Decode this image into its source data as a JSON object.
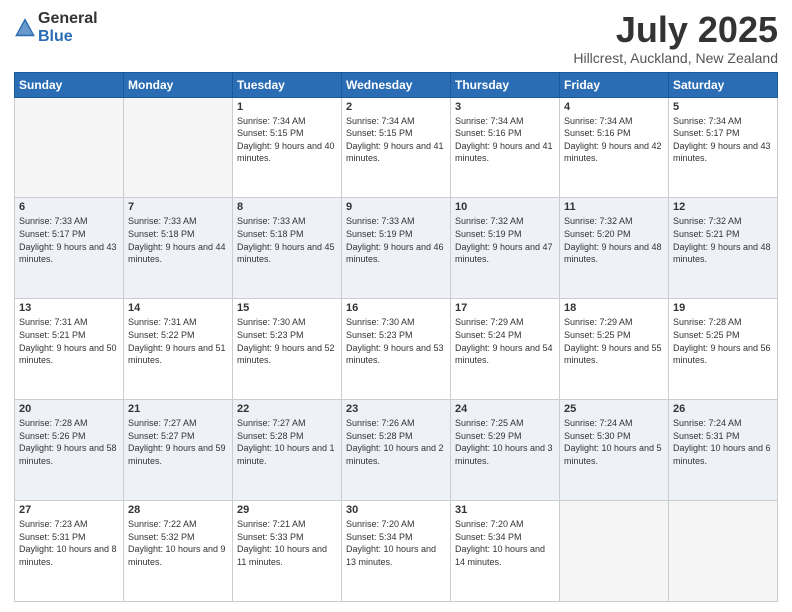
{
  "logo": {
    "general": "General",
    "blue": "Blue"
  },
  "title": "July 2025",
  "location": "Hillcrest, Auckland, New Zealand",
  "headers": [
    "Sunday",
    "Monday",
    "Tuesday",
    "Wednesday",
    "Thursday",
    "Friday",
    "Saturday"
  ],
  "weeks": [
    [
      {
        "day": "",
        "info": ""
      },
      {
        "day": "",
        "info": ""
      },
      {
        "day": "1",
        "info": "Sunrise: 7:34 AM\nSunset: 5:15 PM\nDaylight: 9 hours and 40 minutes."
      },
      {
        "day": "2",
        "info": "Sunrise: 7:34 AM\nSunset: 5:15 PM\nDaylight: 9 hours and 41 minutes."
      },
      {
        "day": "3",
        "info": "Sunrise: 7:34 AM\nSunset: 5:16 PM\nDaylight: 9 hours and 41 minutes."
      },
      {
        "day": "4",
        "info": "Sunrise: 7:34 AM\nSunset: 5:16 PM\nDaylight: 9 hours and 42 minutes."
      },
      {
        "day": "5",
        "info": "Sunrise: 7:34 AM\nSunset: 5:17 PM\nDaylight: 9 hours and 43 minutes."
      }
    ],
    [
      {
        "day": "6",
        "info": "Sunrise: 7:33 AM\nSunset: 5:17 PM\nDaylight: 9 hours and 43 minutes."
      },
      {
        "day": "7",
        "info": "Sunrise: 7:33 AM\nSunset: 5:18 PM\nDaylight: 9 hours and 44 minutes."
      },
      {
        "day": "8",
        "info": "Sunrise: 7:33 AM\nSunset: 5:18 PM\nDaylight: 9 hours and 45 minutes."
      },
      {
        "day": "9",
        "info": "Sunrise: 7:33 AM\nSunset: 5:19 PM\nDaylight: 9 hours and 46 minutes."
      },
      {
        "day": "10",
        "info": "Sunrise: 7:32 AM\nSunset: 5:19 PM\nDaylight: 9 hours and 47 minutes."
      },
      {
        "day": "11",
        "info": "Sunrise: 7:32 AM\nSunset: 5:20 PM\nDaylight: 9 hours and 48 minutes."
      },
      {
        "day": "12",
        "info": "Sunrise: 7:32 AM\nSunset: 5:21 PM\nDaylight: 9 hours and 48 minutes."
      }
    ],
    [
      {
        "day": "13",
        "info": "Sunrise: 7:31 AM\nSunset: 5:21 PM\nDaylight: 9 hours and 50 minutes."
      },
      {
        "day": "14",
        "info": "Sunrise: 7:31 AM\nSunset: 5:22 PM\nDaylight: 9 hours and 51 minutes."
      },
      {
        "day": "15",
        "info": "Sunrise: 7:30 AM\nSunset: 5:23 PM\nDaylight: 9 hours and 52 minutes."
      },
      {
        "day": "16",
        "info": "Sunrise: 7:30 AM\nSunset: 5:23 PM\nDaylight: 9 hours and 53 minutes."
      },
      {
        "day": "17",
        "info": "Sunrise: 7:29 AM\nSunset: 5:24 PM\nDaylight: 9 hours and 54 minutes."
      },
      {
        "day": "18",
        "info": "Sunrise: 7:29 AM\nSunset: 5:25 PM\nDaylight: 9 hours and 55 minutes."
      },
      {
        "day": "19",
        "info": "Sunrise: 7:28 AM\nSunset: 5:25 PM\nDaylight: 9 hours and 56 minutes."
      }
    ],
    [
      {
        "day": "20",
        "info": "Sunrise: 7:28 AM\nSunset: 5:26 PM\nDaylight: 9 hours and 58 minutes."
      },
      {
        "day": "21",
        "info": "Sunrise: 7:27 AM\nSunset: 5:27 PM\nDaylight: 9 hours and 59 minutes."
      },
      {
        "day": "22",
        "info": "Sunrise: 7:27 AM\nSunset: 5:28 PM\nDaylight: 10 hours and 1 minute."
      },
      {
        "day": "23",
        "info": "Sunrise: 7:26 AM\nSunset: 5:28 PM\nDaylight: 10 hours and 2 minutes."
      },
      {
        "day": "24",
        "info": "Sunrise: 7:25 AM\nSunset: 5:29 PM\nDaylight: 10 hours and 3 minutes."
      },
      {
        "day": "25",
        "info": "Sunrise: 7:24 AM\nSunset: 5:30 PM\nDaylight: 10 hours and 5 minutes."
      },
      {
        "day": "26",
        "info": "Sunrise: 7:24 AM\nSunset: 5:31 PM\nDaylight: 10 hours and 6 minutes."
      }
    ],
    [
      {
        "day": "27",
        "info": "Sunrise: 7:23 AM\nSunset: 5:31 PM\nDaylight: 10 hours and 8 minutes."
      },
      {
        "day": "28",
        "info": "Sunrise: 7:22 AM\nSunset: 5:32 PM\nDaylight: 10 hours and 9 minutes."
      },
      {
        "day": "29",
        "info": "Sunrise: 7:21 AM\nSunset: 5:33 PM\nDaylight: 10 hours and 11 minutes."
      },
      {
        "day": "30",
        "info": "Sunrise: 7:20 AM\nSunset: 5:34 PM\nDaylight: 10 hours and 13 minutes."
      },
      {
        "day": "31",
        "info": "Sunrise: 7:20 AM\nSunset: 5:34 PM\nDaylight: 10 hours and 14 minutes."
      },
      {
        "day": "",
        "info": ""
      },
      {
        "day": "",
        "info": ""
      }
    ]
  ]
}
